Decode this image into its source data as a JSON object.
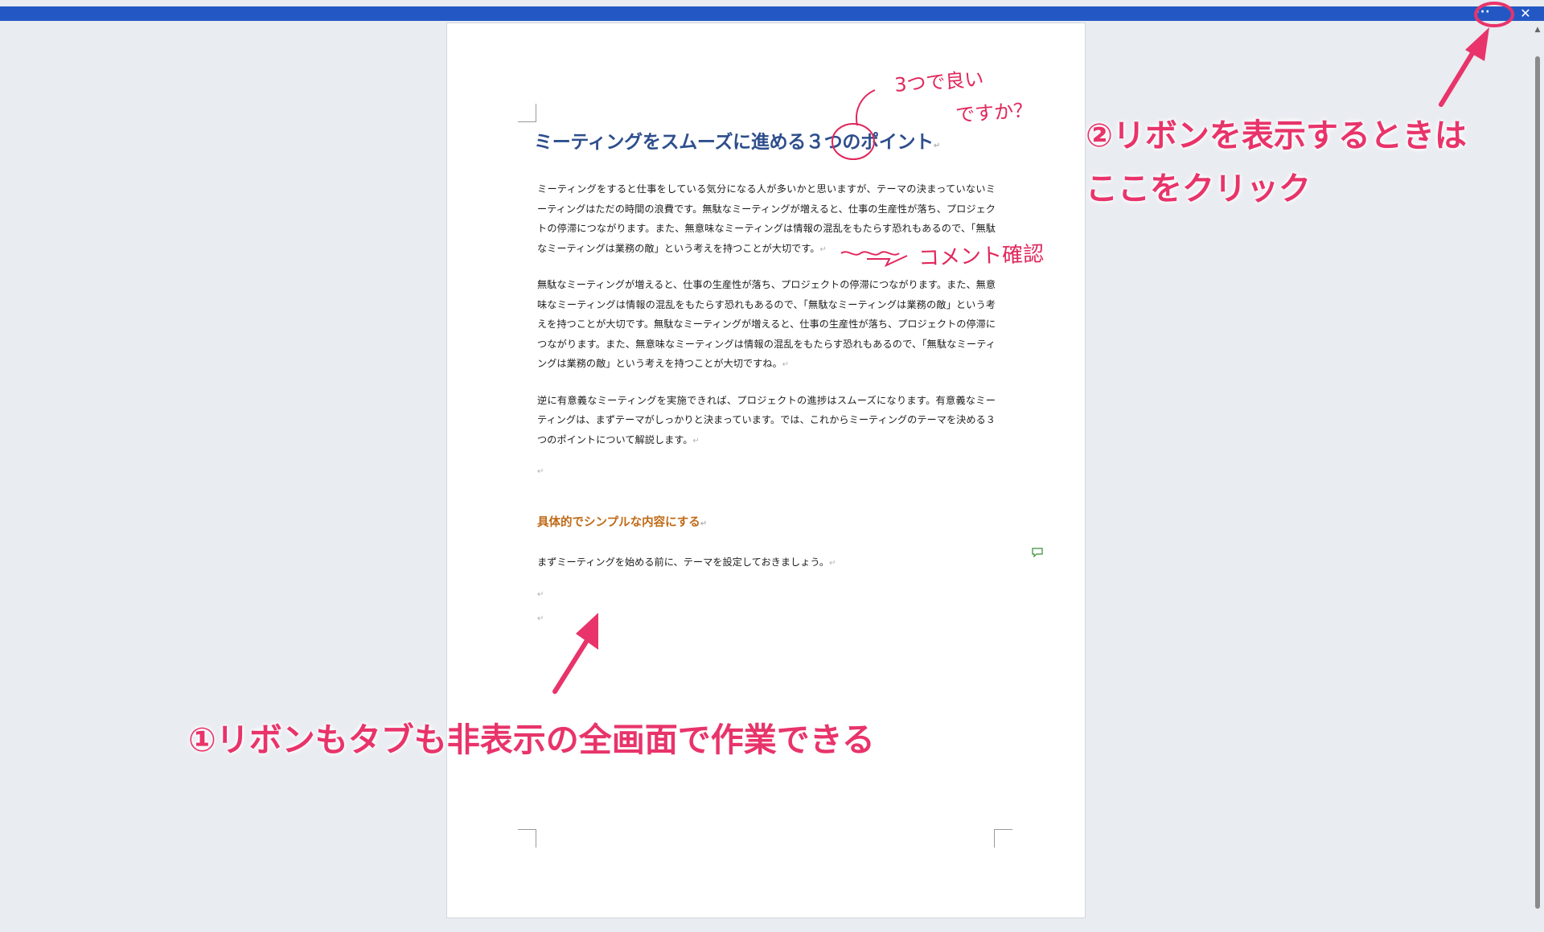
{
  "toolbar": {
    "more_label": "···",
    "close_label": "✕"
  },
  "document": {
    "title": "ミーティングをスムーズに進める３つのポイント",
    "paragraphs": [
      "ミーティングをすると仕事をしている気分になる人が多いかと思いますが、テーマの決まっていないミーティングはただの時間の浪費です。無駄なミーティングが増えると、仕事の生産性が落ち、プロジェクトの停滞につながります。また、無意味なミーティングは情報の混乱をもたらす恐れもあるので、「無駄なミーティングは業務の敵」という考えを持つことが大切です。",
      "無駄なミーティングが増えると、仕事の生産性が落ち、プロジェクトの停滞につながります。また、無意味なミーティングは情報の混乱をもたらす恐れもあるので、「無駄なミーティングは業務の敵」という考えを持つことが大切です。無駄なミーティングが増えると、仕事の生産性が落ち、プロジェクトの停滞につながります。また、無意味なミーティングは情報の混乱をもたらす恐れもあるので、「無駄なミーティングは業務の敵」という考えを持つことが大切ですね。",
      "逆に有意義なミーティングを実施できれば、プロジェクトの進捗はスムーズになります。有意義なミーティングは、まずテーマがしっかりと決まっています。では、これからミーティングのテーマを決める３つのポイントについて解説します。"
    ],
    "heading": "具体的でシンプルな内容にする",
    "body_line": "まずミーティングを始める前に、テーマを設定しておきましょう。",
    "paragraph_mark": "↵"
  },
  "annotations": {
    "ribbon_show_line1": "②リボンを表示するときは",
    "ribbon_show_line2": "ここをクリック",
    "fullscreen_note": "①リボンもタブも非表示の全画面で作業できる",
    "handwritten_1": "3つで良い",
    "handwritten_2": "ですか？",
    "handwritten_3": "コメント確認"
  },
  "colors": {
    "title_bar": "#2358c4",
    "title_text": "#2e4e8c",
    "heading_text": "#c06a16",
    "annotation": "#e8346a"
  }
}
